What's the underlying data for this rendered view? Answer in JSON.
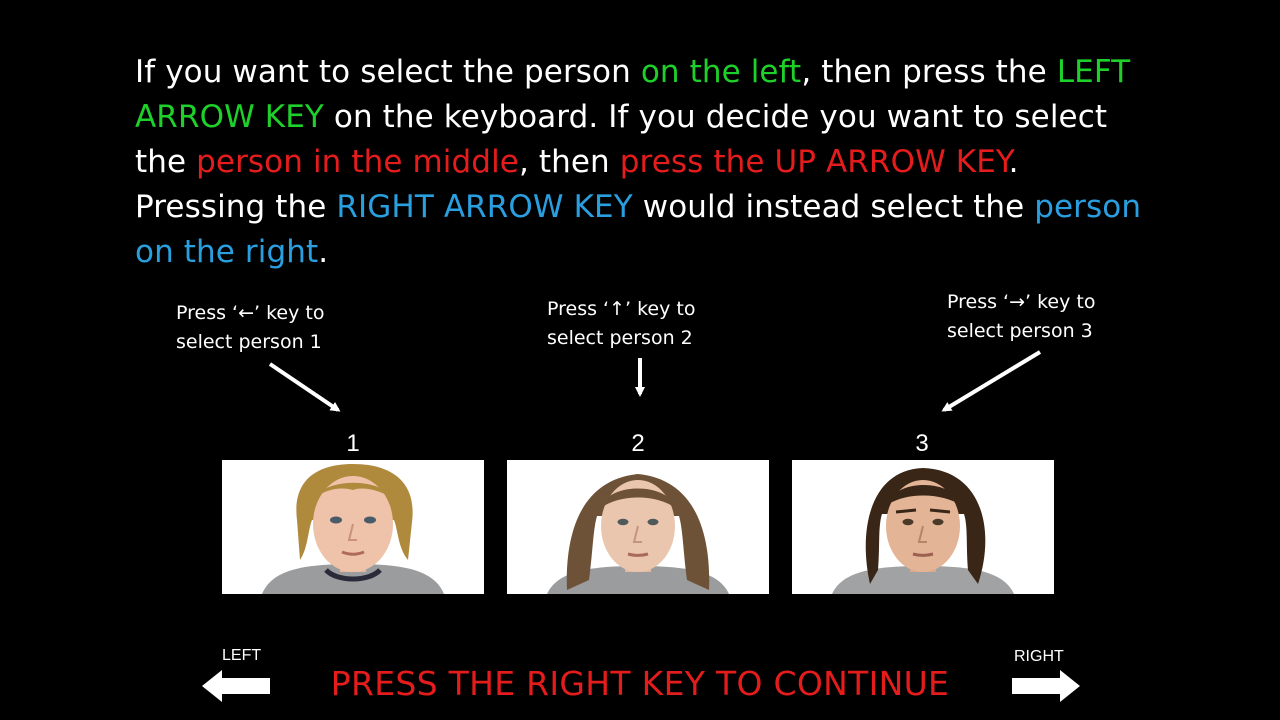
{
  "instructions": {
    "s1": "If you want to select the person ",
    "s2": "on the left",
    "s3": ", then press the ",
    "s4": "LEFT ARROW KEY",
    "s5": " on the keyboard. If you decide you want to select the ",
    "s6": "person in the middle",
    "s7": ", then ",
    "s8": "press the UP ARROW KEY",
    "s9": ". Pressing the ",
    "s10": "RIGHT ARROW KEY",
    "s11": " would instead select the ",
    "s12": "person on the right",
    "s13": "."
  },
  "hints": [
    {
      "line1": "Press ‘←’ key to",
      "line2": "select person 1"
    },
    {
      "line1": "Press ‘↑’ key to",
      "line2": "select person 2"
    },
    {
      "line1": "Press ‘→’ key to",
      "line2": "select person 3"
    }
  ],
  "persons": [
    {
      "number": "1",
      "hair": "#b08a3c",
      "icon": "face-photo"
    },
    {
      "number": "2",
      "hair": "#6e5238",
      "icon": "face-photo"
    },
    {
      "number": "3",
      "hair": "#3a2616",
      "icon": "face-photo"
    }
  ],
  "nav": {
    "left_label": "LEFT",
    "right_label": "RIGHT",
    "left_icon": "left-arrow-icon",
    "right_icon": "right-arrow-icon"
  },
  "continue_text": "PRESS THE RIGHT KEY TO CONTINUE",
  "colors": {
    "green": "#1ed12a",
    "red": "#e51c1c",
    "blue": "#2a9fe0",
    "background": "#000000"
  }
}
